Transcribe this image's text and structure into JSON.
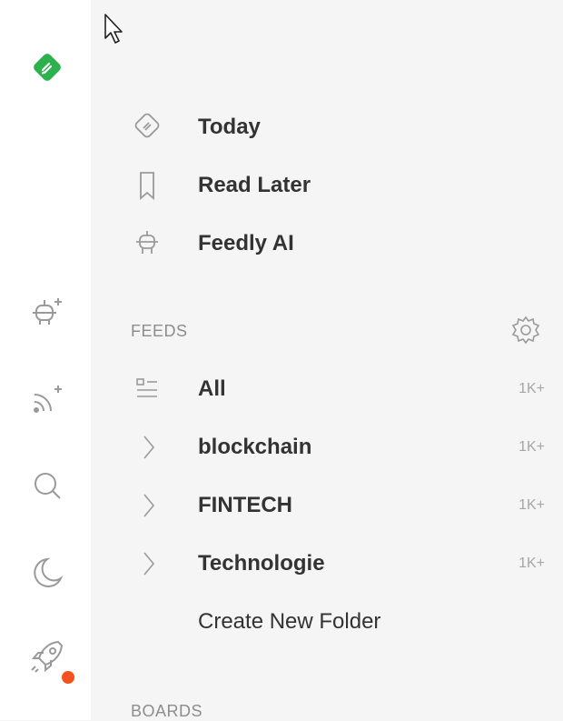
{
  "nav": {
    "today": "Today",
    "read_later": "Read Later",
    "feedly_ai": "Feedly AI"
  },
  "feeds": {
    "section_title": "FEEDS",
    "items": [
      {
        "label": "All",
        "count": "1K+"
      },
      {
        "label": "blockchain",
        "count": "1K+"
      },
      {
        "label": "FINTECH",
        "count": "1K+"
      },
      {
        "label": "Technologie",
        "count": "1K+"
      }
    ],
    "create_folder": "Create New Folder"
  },
  "boards": {
    "section_title": "BOARDS"
  },
  "rail": {
    "icons": [
      "feedly-logo-icon",
      "add-ai-feed-icon",
      "add-rss-feed-icon",
      "search-icon",
      "dark-mode-moon-icon",
      "rocket-icon"
    ],
    "notification_dot": "#f4511e"
  },
  "colors": {
    "brand_green": "#2bb24c",
    "text": "#333333",
    "muted": "#8d8d8d",
    "icon_gray": "#9a9a9a"
  }
}
